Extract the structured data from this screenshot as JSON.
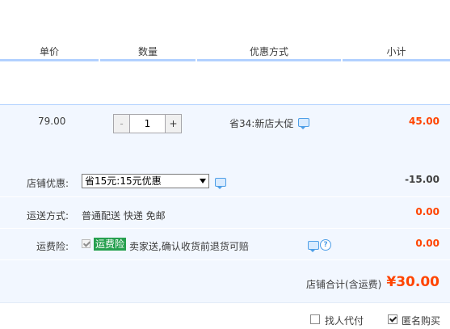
{
  "header": {
    "unit_price": "单价",
    "quantity": "数量",
    "discount": "优惠方式",
    "subtotal": "小计"
  },
  "item": {
    "price": "79.00",
    "quantity": "1",
    "minus": "-",
    "plus": "+",
    "promo": "省34:新店大促",
    "subtotal": "45.00"
  },
  "shop_discount": {
    "label": "店铺优惠:",
    "selected": "省15元:15元优惠",
    "amount": "-15.00"
  },
  "shipping": {
    "label": "运送方式:",
    "method": "普通配送 快递 免邮",
    "amount": "0.00"
  },
  "insurance": {
    "label": "运费险:",
    "tag": "运费险",
    "desc": "卖家送,确认收货前退货可赔",
    "amount": "0.00"
  },
  "total": {
    "label": "店铺合计(含运费)",
    "amount": "¥30.00"
  },
  "options": {
    "proxy_pay": "找人代付",
    "anonymous": "匿名购买",
    "proxy_checked": false,
    "anonymous_checked": true
  }
}
